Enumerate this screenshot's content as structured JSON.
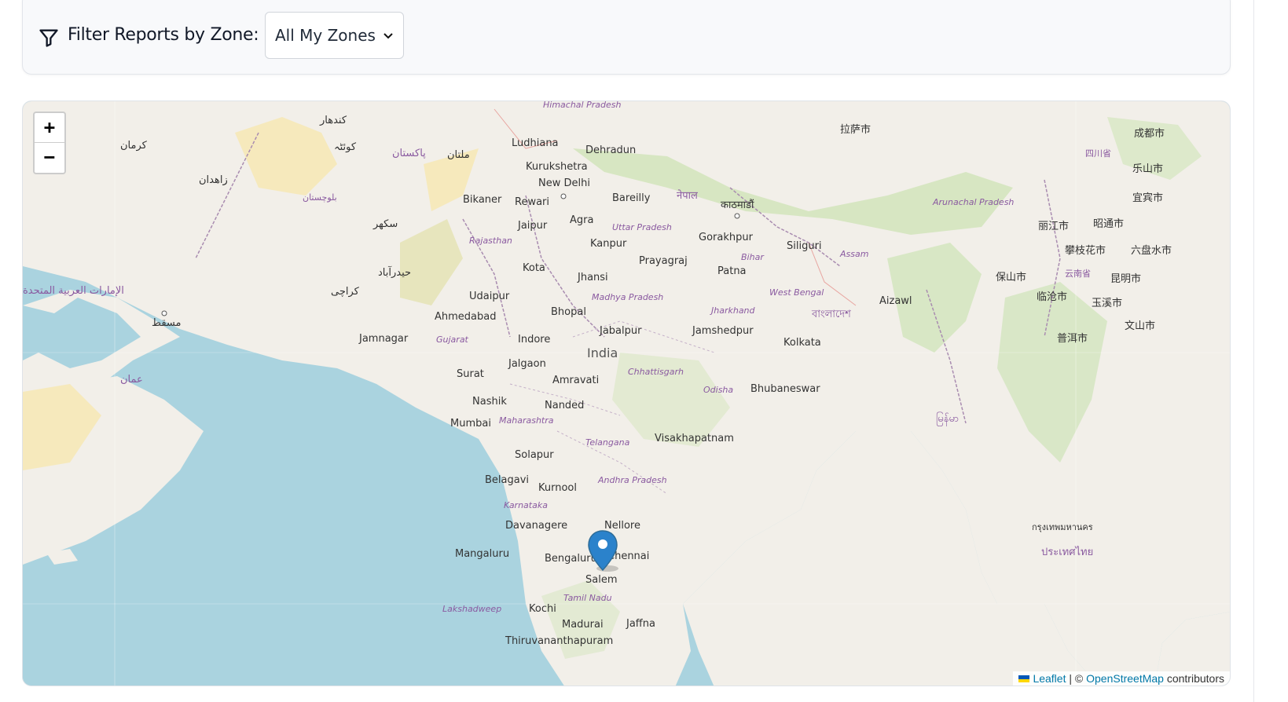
{
  "filter": {
    "label": "Filter Reports by Zone:",
    "icon": "filter-icon",
    "select_value": "All My Zones",
    "options": [
      "All My Zones"
    ]
  },
  "map": {
    "zoom_in": "+",
    "zoom_out": "−",
    "marker_city": "Bengaluru",
    "attribution": {
      "leaflet": "Leaflet",
      "separator": "| ©",
      "osm": "OpenStreetMap",
      "suffix": "contributors"
    },
    "labels": {
      "himachal": "Himachal Pradesh",
      "ludhiana": "Ludhiana",
      "dehradun": "Dehradun",
      "kurukshetra": "Kurukshetra",
      "new_delhi": "New Delhi",
      "bareilly": "Bareilly",
      "nepal": "नेपाल",
      "kathmandu": "काठमाडौं",
      "lhasa": "拉萨市",
      "bikaner": "Bikaner",
      "rewari": "Rewari",
      "agra": "Agra",
      "jaipur": "Jaipur",
      "uttar_pradesh": "Uttar Pradesh",
      "gorakhpur": "Gorakhpur",
      "siliguri": "Siliguri",
      "rajasthan": "Rajasthan",
      "kanpur": "Kanpur",
      "prayagraj": "Prayagraj",
      "bihar": "Bihar",
      "assam": "Assam",
      "arunachal": "Arunachal Pradesh",
      "kota": "Kota",
      "jhansi": "Jhansi",
      "patna": "Patna",
      "udaipur": "Udaipur",
      "madhya": "Madhya Pradesh",
      "west_bengal": "West Bengal",
      "aizawl": "Aizawl",
      "ahmedabad": "Ahmedabad",
      "bhopal": "Bhopal",
      "jharkhand": "Jharkhand",
      "bangladesh": "বাংলাদেশ",
      "jabalpur": "Jabalpur",
      "jamshedpur": "Jamshedpur",
      "jamnagar": "Jamnagar",
      "gujarat": "Gujarat",
      "indore": "Indore",
      "india": "India",
      "kolkata": "Kolkata",
      "jalgaon": "Jalgaon",
      "chhattisgarh": "Chhattisgarh",
      "surat": "Surat",
      "amravati": "Amravati",
      "odisha": "Odisha",
      "bhubaneswar": "Bhubaneswar",
      "nashik": "Nashik",
      "nanded": "Nanded",
      "mumbai": "Mumbai",
      "maharashtra": "Maharashtra",
      "telangana": "Telangana",
      "visakhapatnam": "Visakhapatnam",
      "solapur": "Solapur",
      "belagavi": "Belagavi",
      "kurnool": "Kurnool",
      "andhra": "Andhra Pradesh",
      "karnataka": "Karnataka",
      "davanagere": "Davanagere",
      "nellore": "Nellore",
      "mangaluru": "Mangaluru",
      "bengaluru": "Bengaluru",
      "chennai": "Chennai",
      "salem": "Salem",
      "tamil_nadu": "Tamil Nadu",
      "lakshadweep": "Lakshadweep",
      "kochi": "Kochi",
      "madurai": "Madurai",
      "jaffna": "Jaffna",
      "thiruvananthapuram": "Thiruvananthapuram",
      "chengdu": "成都市",
      "leshan": "乐山市",
      "yibin": "宜宾市",
      "lijiang": "丽江市",
      "zhaotong": "昭通市",
      "panzhihua": "攀枝花市",
      "liupanshui": "六盘水市",
      "baoshan": "保山市",
      "kunming": "昆明市",
      "yunnan": "云南省",
      "lincang": "临沧市",
      "yuxi": "玉溪市",
      "wenshan": "文山市",
      "puer": "普洱市",
      "sichuan": "四川省",
      "myanmar": "မြန်မာ",
      "thailand": "ประเทศไทย",
      "bangkok": "กรุงเทพมหานคร",
      "karachi": "كراچی",
      "pakistan": "پاکستان",
      "multan": "ملتان",
      "oman": "عمان",
      "muscat": "مسقط",
      "uae": "الإمارات العربية المتحدة",
      "kerman": "کرمان",
      "zahedan": "زاهدان",
      "balochistan": "بلوچستان",
      "sukkur": "سکھر",
      "hyderabad_pk": "حیدرآباد",
      "quetta": "کوئٹہ",
      "kandahar": "کندهار"
    }
  },
  "colors": {
    "sea": "#aad3df",
    "land": "#f2efe9",
    "forest": "#cfe4b8",
    "desert": "#f6e7b0",
    "border": "#a98cb0",
    "marker": "#2b82cb",
    "link": "#0078a8"
  }
}
